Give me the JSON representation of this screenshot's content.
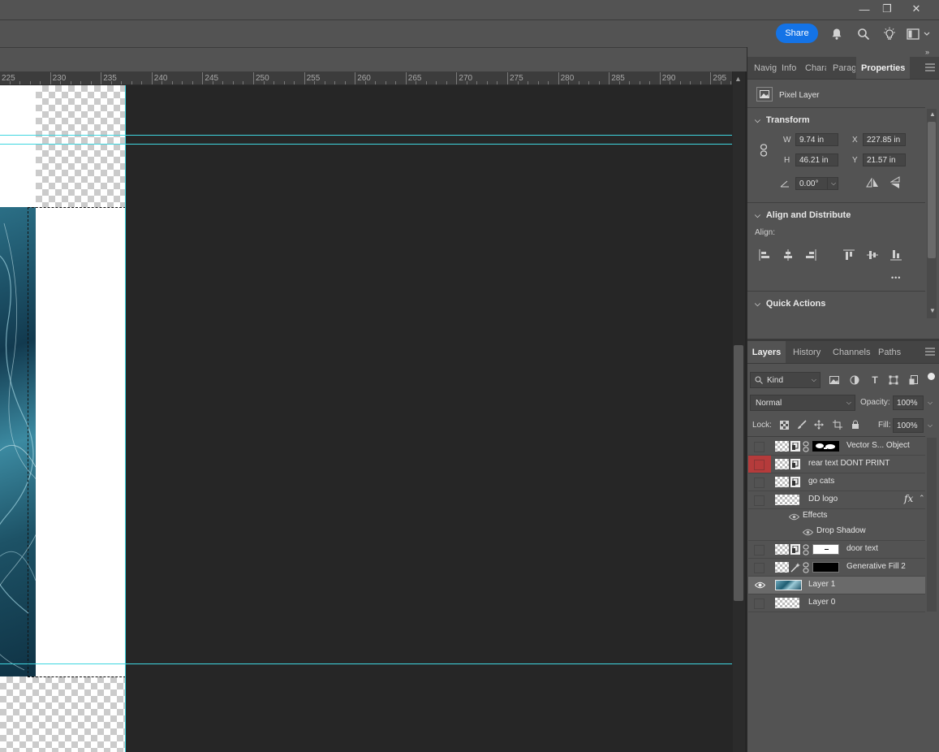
{
  "window": {
    "minimize": "—",
    "restore": "❐",
    "close": "✕"
  },
  "options_bar": {
    "share_label": "Share",
    "icons": [
      "bell-icon",
      "search-icon",
      "lightbulb-icon",
      "workspace-icon"
    ]
  },
  "ruler": {
    "labels": [
      "225",
      "230",
      "235",
      "240",
      "245",
      "250",
      "255",
      "260",
      "265",
      "270",
      "275",
      "280",
      "285",
      "290",
      "295"
    ]
  },
  "properties_panel": {
    "tabs": [
      "Navig",
      "Info",
      "Chara",
      "Parag",
      "Properties"
    ],
    "layer_type": "Pixel Layer",
    "transform": {
      "title": "Transform",
      "w_label": "W",
      "w": "9.74 in",
      "x_label": "X",
      "x": "227.85 in",
      "h_label": "H",
      "h": "46.21 in",
      "y_label": "Y",
      "y": "21.57 in",
      "angle": "0.00°"
    },
    "align": {
      "title": "Align and Distribute",
      "align_label": "Align:",
      "more": "•••"
    },
    "quick_actions": {
      "title": "Quick Actions"
    }
  },
  "layers_panel": {
    "tabs": [
      "Layers",
      "History",
      "Channels",
      "Paths"
    ],
    "kind_label": "Kind",
    "blend_mode": "Normal",
    "opacity_label": "Opacity:",
    "opacity": "100%",
    "lock_label": "Lock:",
    "fill_label": "Fill:",
    "fill": "100%",
    "layers": [
      {
        "name": "Vector S... Object"
      },
      {
        "name": "rear text DONT PRINT"
      },
      {
        "name": "go cats"
      },
      {
        "name": "DD logo",
        "fx": "fx"
      },
      {
        "name": "Effects"
      },
      {
        "name": "Drop Shadow"
      },
      {
        "name": "door text"
      },
      {
        "name": "Generative Fill 2"
      },
      {
        "name": "Layer 1"
      },
      {
        "name": "Layer 0"
      }
    ]
  },
  "colors": {
    "accent": "#1473e6",
    "guide": "#3fd6e0",
    "tag_red": "#b53b3b"
  }
}
